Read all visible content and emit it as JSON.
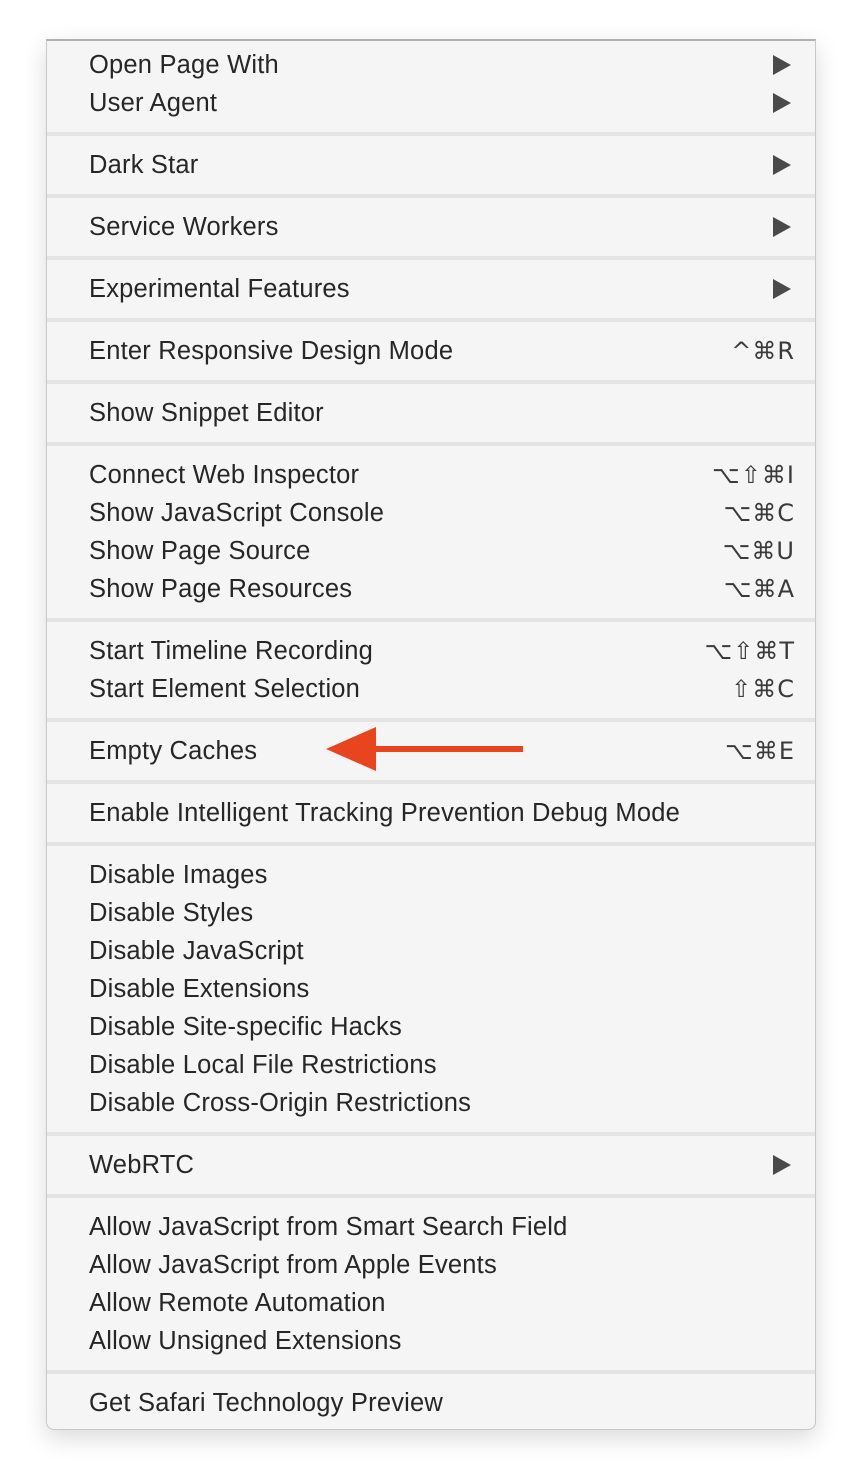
{
  "menu": {
    "groups": [
      [
        {
          "label": "Open Page With",
          "submenu": true
        },
        {
          "label": "User Agent",
          "submenu": true
        }
      ],
      [
        {
          "label": "Dark Star",
          "submenu": true
        }
      ],
      [
        {
          "label": "Service Workers",
          "submenu": true
        }
      ],
      [
        {
          "label": "Experimental Features",
          "submenu": true
        }
      ],
      [
        {
          "label": "Enter Responsive Design Mode",
          "shortcut": "^⌘R"
        }
      ],
      [
        {
          "label": "Show Snippet Editor"
        }
      ],
      [
        {
          "label": "Connect Web Inspector",
          "shortcut": "⌥⇧⌘I"
        },
        {
          "label": "Show JavaScript Console",
          "shortcut": "⌥⌘C"
        },
        {
          "label": "Show Page Source",
          "shortcut": "⌥⌘U"
        },
        {
          "label": "Show Page Resources",
          "shortcut": "⌥⌘A"
        }
      ],
      [
        {
          "label": "Start Timeline Recording",
          "shortcut": "⌥⇧⌘T"
        },
        {
          "label": "Start Element Selection",
          "shortcut": "⇧⌘C"
        }
      ],
      [
        {
          "label": "Empty Caches",
          "shortcut": "⌥⌘E"
        }
      ],
      [
        {
          "label": "Enable Intelligent Tracking Prevention Debug Mode"
        }
      ],
      [
        {
          "label": "Disable Images"
        },
        {
          "label": "Disable Styles"
        },
        {
          "label": "Disable JavaScript"
        },
        {
          "label": "Disable Extensions"
        },
        {
          "label": "Disable Site-specific Hacks"
        },
        {
          "label": "Disable Local File Restrictions"
        },
        {
          "label": "Disable Cross-Origin Restrictions"
        }
      ],
      [
        {
          "label": "WebRTC",
          "submenu": true
        }
      ],
      [
        {
          "label": "Allow JavaScript from Smart Search Field"
        },
        {
          "label": "Allow JavaScript from Apple Events"
        },
        {
          "label": "Allow Remote Automation"
        },
        {
          "label": "Allow Unsigned Extensions"
        }
      ],
      [
        {
          "label": "Get Safari Technology Preview"
        }
      ]
    ]
  },
  "annotation": {
    "icon": "red-arrow-pointing-left",
    "color": "#e8451e",
    "target": "Empty Caches"
  },
  "colors": {
    "menu_bg": "#f5f5f5",
    "text": "#262626",
    "separator": "#e4e4e4"
  }
}
